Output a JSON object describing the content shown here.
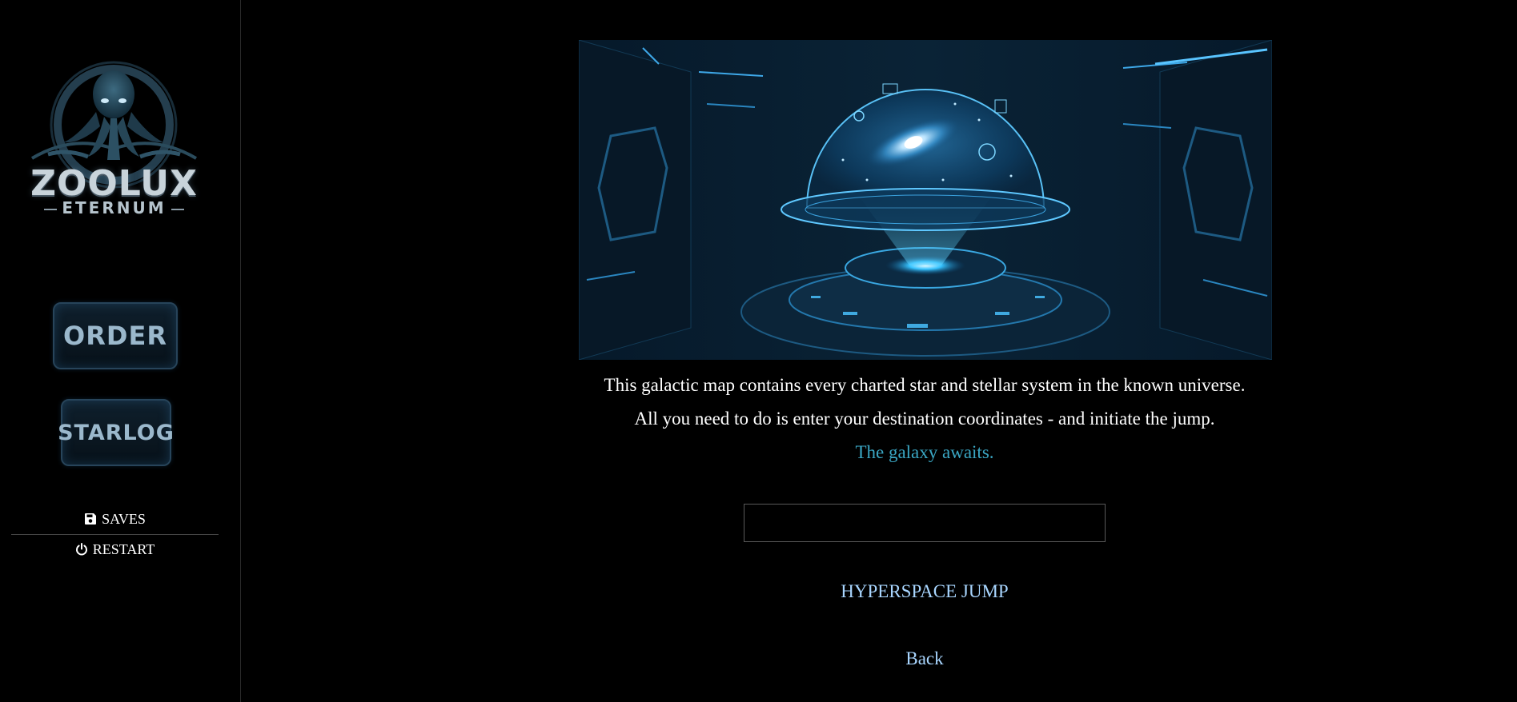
{
  "sidebar": {
    "logo": {
      "title": "ZOOLUX",
      "subtitle": "ETERNUM",
      "icon": "octopus-emblem"
    },
    "buttons": {
      "order": "ORDER",
      "starlog": "STARLOG"
    },
    "menu": {
      "saves": {
        "label": "SAVES",
        "icon": "floppy-disk-icon"
      },
      "restart": {
        "label": "RESTART",
        "icon": "power-icon"
      }
    }
  },
  "main": {
    "hero_image": "holographic-galaxy-map",
    "paragraphs": {
      "line1": "This galactic map contains every charted star and stellar system in the known universe.",
      "line2": "All you need to do is enter your destination coordinates - and initiate the jump.",
      "line3": "The galaxy awaits."
    },
    "coordinates_input": {
      "value": "",
      "placeholder": ""
    },
    "jump_label": "HYPERSPACE JUMP",
    "back_label": "Back"
  },
  "colors": {
    "background": "#000000",
    "text": "#ffffff",
    "accent": "#3aa6c3",
    "link": "#a9d6ff"
  }
}
